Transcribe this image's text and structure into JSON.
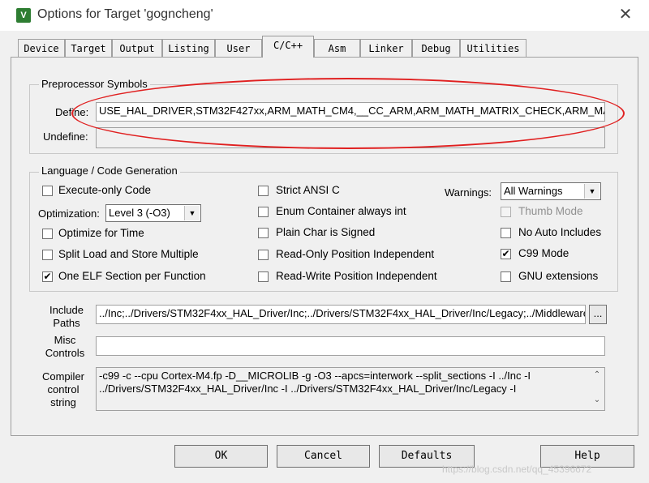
{
  "window": {
    "icon": "keil-uv-icon",
    "title": "Options for Target 'gogncheng'"
  },
  "tabs": [
    {
      "label": "Device",
      "active": false
    },
    {
      "label": "Target",
      "active": false
    },
    {
      "label": "Output",
      "active": false
    },
    {
      "label": "Listing",
      "active": false
    },
    {
      "label": "User",
      "active": false
    },
    {
      "label": "C/C++",
      "active": true
    },
    {
      "label": "Asm",
      "active": false
    },
    {
      "label": "Linker",
      "active": false
    },
    {
      "label": "Debug",
      "active": false
    },
    {
      "label": "Utilities",
      "active": false
    }
  ],
  "preprocessor": {
    "group_label": "Preprocessor Symbols",
    "define_label": "Define:",
    "define_value": "USE_HAL_DRIVER,STM32F427xx,ARM_MATH_CM4,__CC_ARM,ARM_MATH_MATRIX_CHECK,ARM_MATH_ROUNDING",
    "undefine_label": "Undefine:",
    "undefine_value": ""
  },
  "language": {
    "group_label": "Language / Code Generation",
    "execute_only": {
      "label": "Execute-only Code",
      "checked": false
    },
    "optimization_label": "Optimization:",
    "optimization_value": "Level 3 (-O3)",
    "optimize_time": {
      "label": "Optimize for Time",
      "checked": false
    },
    "split_load": {
      "label": "Split Load and Store Multiple",
      "checked": false
    },
    "one_elf": {
      "label": "One ELF Section per Function",
      "checked": true
    },
    "strict_ansi": {
      "label": "Strict ANSI C",
      "checked": false
    },
    "enum_container": {
      "label": "Enum Container always int",
      "checked": false
    },
    "plain_char": {
      "label": "Plain Char is Signed",
      "checked": false
    },
    "ro_pi": {
      "label": "Read-Only Position Independent",
      "checked": false
    },
    "rw_pi": {
      "label": "Read-Write Position Independent",
      "checked": false
    },
    "warnings_label": "Warnings:",
    "warnings_value": "All Warnings",
    "thumb_mode": {
      "label": "Thumb Mode",
      "checked": false,
      "disabled": true
    },
    "no_auto_includes": {
      "label": "No Auto Includes",
      "checked": false
    },
    "c99_mode": {
      "label": "C99 Mode",
      "checked": true
    },
    "gnu_ext": {
      "label": "GNU extensions",
      "checked": false
    }
  },
  "include_paths": {
    "label_line1": "Include",
    "label_line2": "Paths",
    "value": "../Inc;../Drivers/STM32F4xx_HAL_Driver/Inc;../Drivers/STM32F4xx_HAL_Driver/Inc/Legacy;../Middlewares",
    "browse_label": "..."
  },
  "misc_controls": {
    "label_line1": "Misc",
    "label_line2": "Controls",
    "value": ""
  },
  "compiler_control": {
    "label_line1": "Compiler",
    "label_line2": "control",
    "label_line3": "string",
    "line1": "-c99 -c --cpu Cortex-M4.fp -D__MICROLIB -g -O3 --apcs=interwork --split_sections -I ../Inc -I",
    "line2": "../Drivers/STM32F4xx_HAL_Driver/Inc -I ../Drivers/STM32F4xx_HAL_Driver/Inc/Legacy -I"
  },
  "buttons": {
    "ok": "OK",
    "cancel": "Cancel",
    "defaults": "Defaults",
    "help": "Help"
  },
  "glyphs": {
    "check": "✔",
    "dropdown": "▼",
    "scroll_up": "⌃",
    "scroll_down": "⌄",
    "close": "✕"
  },
  "watermark": "https://blog.csdn.net/qq_45396672",
  "annotation_color": "#e02020"
}
